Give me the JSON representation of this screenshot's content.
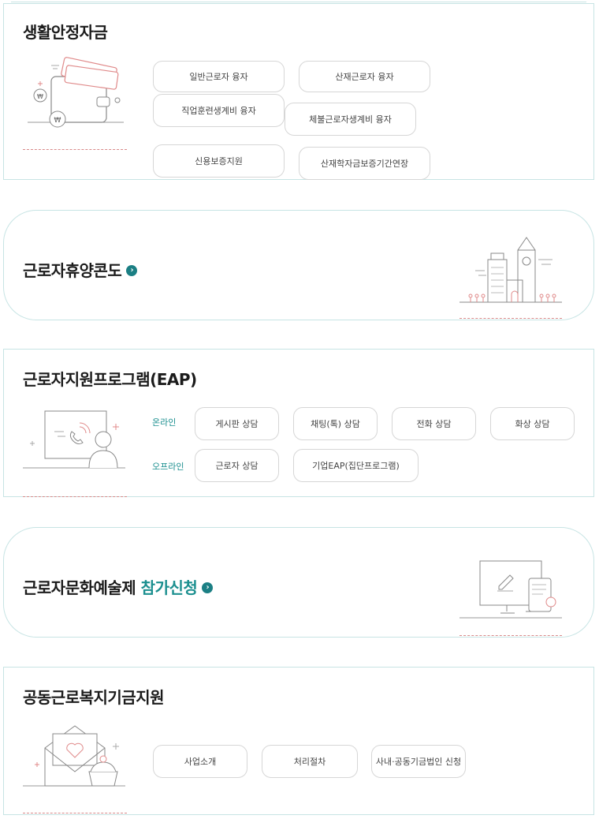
{
  "living_fund": {
    "title": "생활안정자금",
    "buttons": [
      "일반근로자 융자",
      "산재근로자 융자",
      "직업훈련생계비 융자",
      "체불근로자생계비 융자",
      "신용보증지원",
      "산재학자금보증기간연장"
    ]
  },
  "condo": {
    "title": "근로자휴양콘도"
  },
  "eap": {
    "title": "근로자지원프로그램(EAP)",
    "online_label": "온라인",
    "offline_label": "오프라인",
    "online_buttons": [
      "게시판 상담",
      "채팅(톡) 상담",
      "전화 상담",
      "화상 상담"
    ],
    "offline_buttons": [
      "근로자 상담",
      "기업EAP(집단프로그램)"
    ]
  },
  "arts": {
    "title": "근로자문화예술제",
    "accent": "참가신청"
  },
  "fund": {
    "title": "공동근로복지기금지원",
    "buttons": [
      "사업소개",
      "처리절차",
      "사내·공동기금법인 신청"
    ]
  },
  "icons": {
    "arrow": "›",
    "won": "₩"
  },
  "colors": {
    "accent": "#1b8f8f",
    "border": "#c7e4e4",
    "pink": "#e09090"
  }
}
